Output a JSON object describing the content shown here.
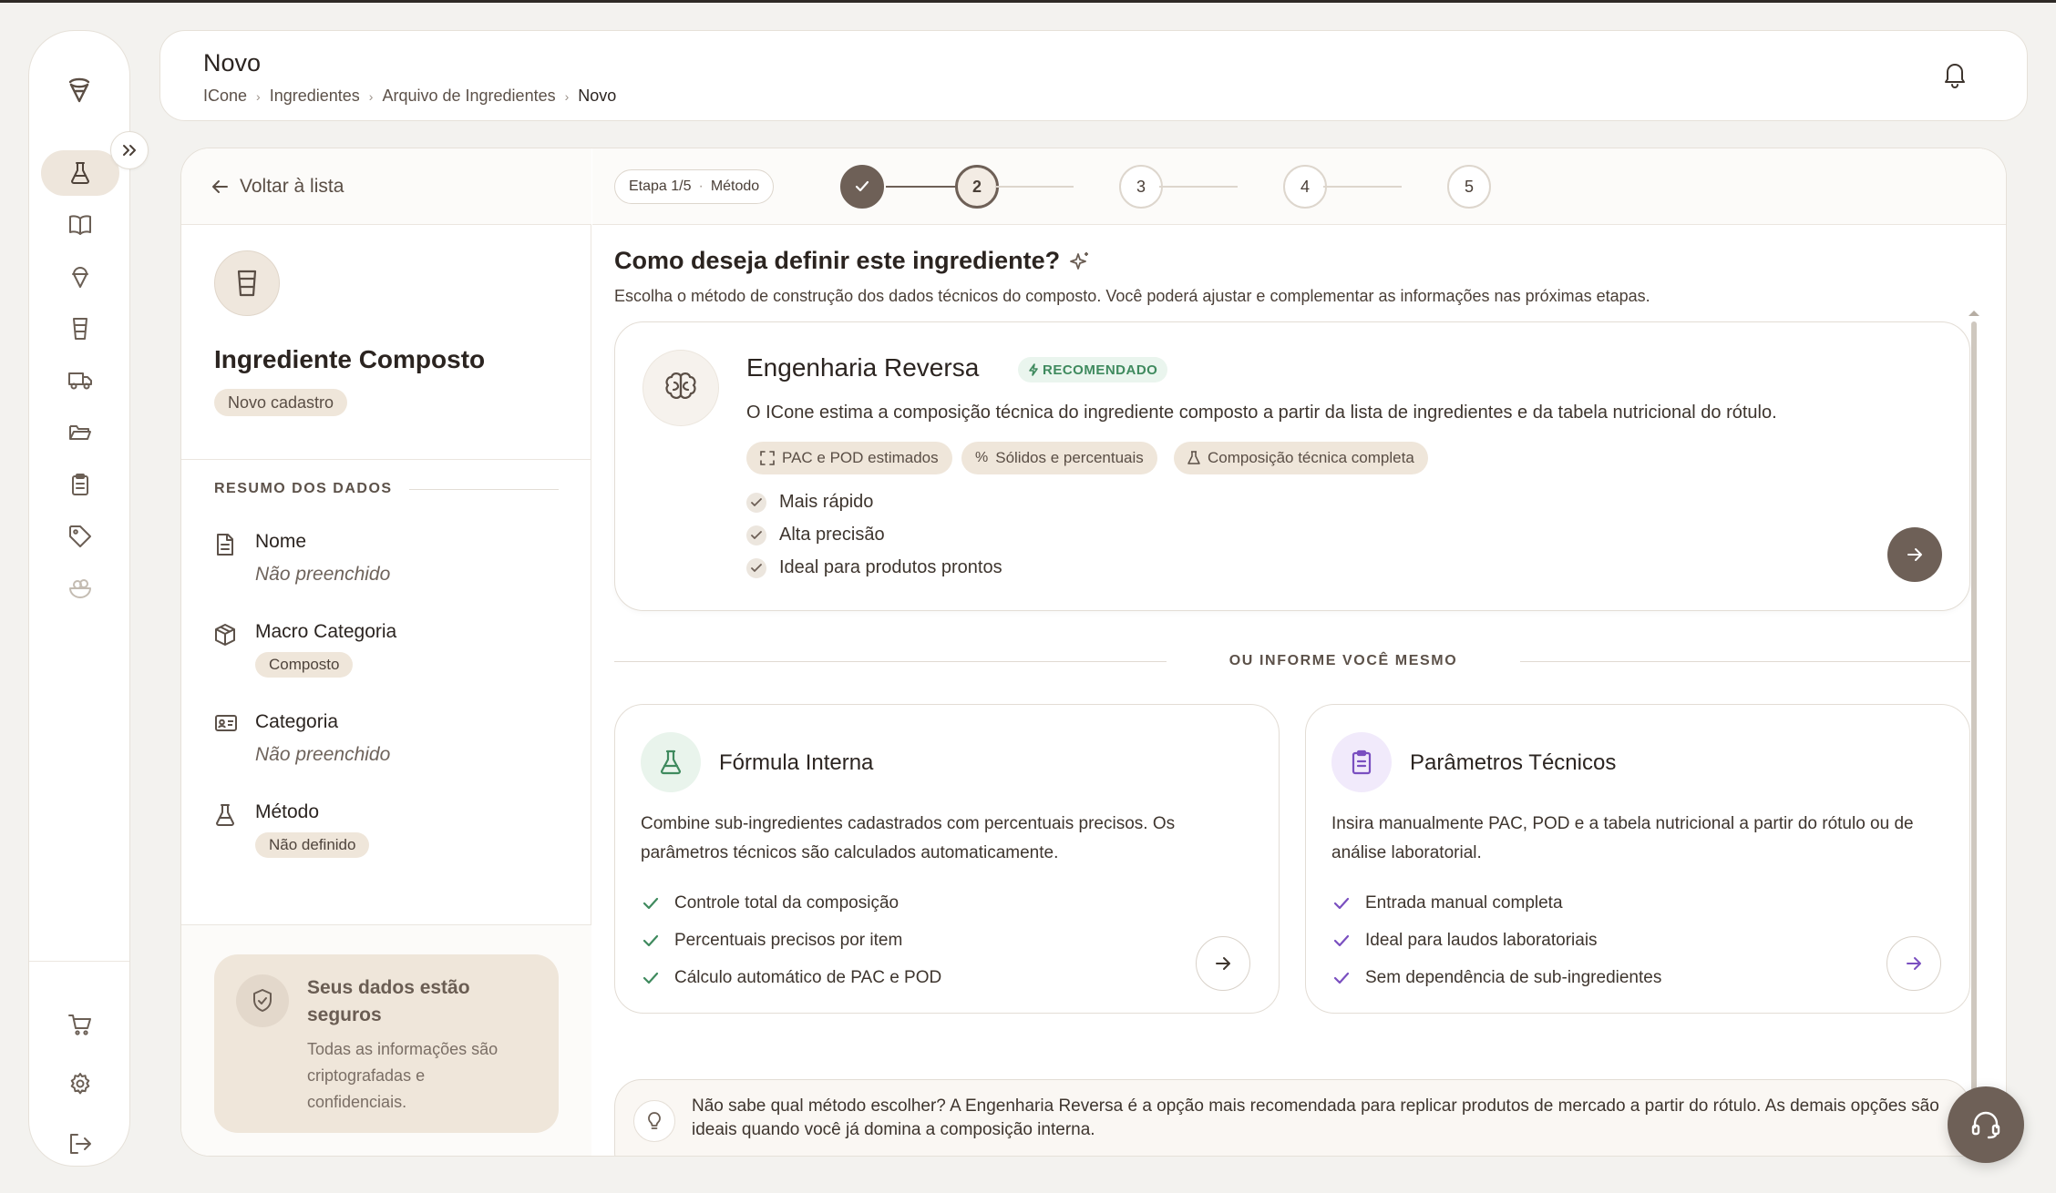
{
  "header": {
    "title": "Novo",
    "breadcrumbs": [
      "ICone",
      "Ingredientes",
      "Arquivo de Ingredientes",
      "Novo"
    ]
  },
  "sidebar": {
    "icons": [
      "logo-icon",
      "flask-icon",
      "book-icon",
      "ice-cream-icon",
      "cup-icon",
      "truck-icon",
      "folder-icon",
      "clipboard-icon",
      "tag-icon",
      "bowl-icon",
      "cart-icon",
      "gear-icon",
      "logout-icon"
    ]
  },
  "left": {
    "back_label": "Voltar à lista",
    "ingredient_name": "Ingrediente Composto",
    "status_badge": "Novo cadastro",
    "summary_title": "RESUMO DOS DADOS",
    "fields": [
      {
        "label": "Nome",
        "value": "Não preenchido"
      },
      {
        "label": "Macro Categoria",
        "value": "Composto"
      },
      {
        "label": "Categoria",
        "value": "Não preenchido"
      },
      {
        "label": "Método",
        "value": "Não definido"
      }
    ],
    "secure": {
      "title": "Seus dados estão seguros",
      "text": "Todas as informações são criptografadas e confidenciais."
    }
  },
  "stepper": {
    "chip_step": "Etapa 1/5",
    "chip_name": "Método",
    "steps": [
      "1",
      "2",
      "3",
      "4",
      "5"
    ]
  },
  "main": {
    "question": "Como deseja definir este ingrediente?",
    "subtitle": "Escolha o método de construção dos dados técnicos do composto. Você poderá ajustar e complementar as informações nas próximas etapas.",
    "reverse": {
      "name": "Engenharia Reversa",
      "badge": "RECOMENDADO",
      "desc": "O ICone estima a composição técnica do ingrediente composto a partir da lista de ingredientes e da tabela nutricional do rótulo.",
      "tags": [
        "PAC e POD estimados",
        "Sólidos e percentuais",
        "Composição técnica completa"
      ],
      "bullets": [
        "Mais rápido",
        "Alta precisão",
        "Ideal para produtos prontos"
      ]
    },
    "divider": "OU INFORME VOCÊ MESMO",
    "formula": {
      "name": "Fórmula Interna",
      "desc": "Combine sub-ingredientes cadastrados com percentuais precisos. Os parâmetros técnicos são calculados automaticamente.",
      "bullets": [
        "Controle total da composição",
        "Percentuais precisos por item",
        "Cálculo automático de PAC e POD"
      ]
    },
    "params": {
      "name": "Parâmetros Técnicos",
      "desc": "Insira manualmente PAC, POD e a tabela nutricional a partir do rótulo ou de análise laboratorial.",
      "bullets": [
        "Entrada manual completa",
        "Ideal para laudos laboratoriais",
        "Sem dependência de sub-ingredientes"
      ]
    },
    "hint": "Não sabe qual método escolher? A Engenharia Reversa é a opção mais recomendada para replicar produtos de mercado a partir do rótulo. As demais opções são ideais quando você já domina a composição interna."
  },
  "colors": {
    "accent": "#6e6057",
    "green": "#3f8a5e",
    "purple": "#7a4fc0",
    "beige": "#efe6da"
  }
}
